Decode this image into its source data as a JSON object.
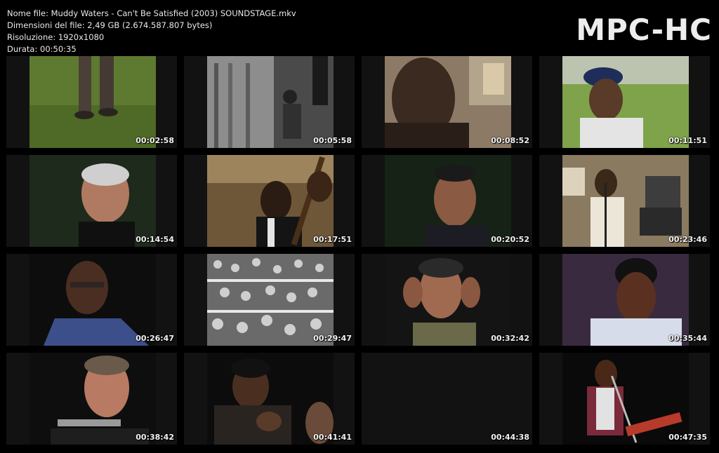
{
  "file_info": {
    "name_line": "Nome file: Muddy Waters - Can't Be Satisfied (2003) SOUNDSTAGE.mkv",
    "size_line": "Dimensioni del file: 2,49 GB (2.674.587.807 bytes)",
    "resolution_line": "Risoluzione: 1920x1080",
    "duration_line": "Durata: 00:50:35"
  },
  "logo": "MPC-HC",
  "thumbnails": [
    {
      "time": "00:02:58",
      "scene": "legs-on-grass"
    },
    {
      "time": "00:05:58",
      "scene": "bw-cabin-porch"
    },
    {
      "time": "00:08:52",
      "scene": "elderly-man-closeup"
    },
    {
      "time": "00:11:51",
      "scene": "man-in-cap-field"
    },
    {
      "time": "00:14:54",
      "scene": "interview-man-dark"
    },
    {
      "time": "00:17:51",
      "scene": "sepia-singer-bass"
    },
    {
      "time": "00:20:52",
      "scene": "interview-young-man"
    },
    {
      "time": "00:23:46",
      "scene": "sepia-singer-microphone"
    },
    {
      "time": "00:26:47",
      "scene": "interview-man-glasses"
    },
    {
      "time": "00:29:47",
      "scene": "bw-crowd"
    },
    {
      "time": "00:32:42",
      "scene": "man-hands-on-head"
    },
    {
      "time": "00:35:44",
      "scene": "performer-stage"
    },
    {
      "time": "00:38:42",
      "scene": "man-with-harmonica"
    },
    {
      "time": "00:41:41",
      "scene": "harmonica-player-stage"
    },
    {
      "time": "00:44:38",
      "scene": "black-frame"
    },
    {
      "time": "00:47:35",
      "scene": "singer-guitar-concert"
    }
  ]
}
